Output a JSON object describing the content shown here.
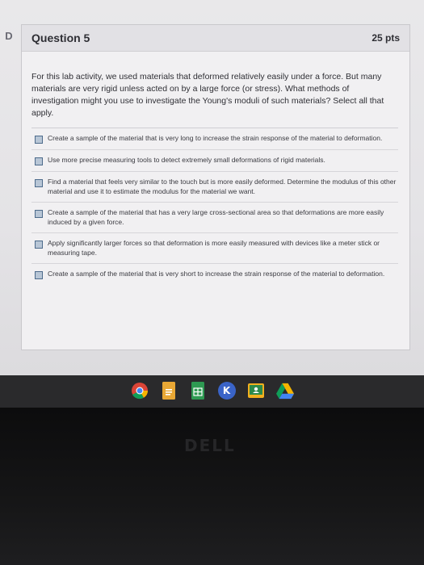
{
  "nav": {
    "side_tab_glyph": "D"
  },
  "question": {
    "title": "Question 5",
    "points": "25 pts",
    "prompt": "For this lab activity, we used materials that deformed relatively easily under a force. But many materials are very rigid unless acted on by a large force (or stress). What methods of investigation might you use to investigate the Young's moduli of such materials? Select all that apply."
  },
  "answers": [
    {
      "text": "Create a sample of the material that is very long to increase the strain response of the material to deformation."
    },
    {
      "text": "Use more precise measuring tools to detect extremely small deformations of rigid materials."
    },
    {
      "text": "Find a material that feels very similar to the touch but is more easily deformed. Determine the modulus of this other material and use it to estimate the modulus for the material we want."
    },
    {
      "text": "Create a sample of the material that has a very large cross-sectional area so that deformations are more easily induced by a given force."
    },
    {
      "text": "Apply significantly larger forces so that deformation is more easily measured with devices like a meter stick or measuring tape."
    },
    {
      "text": "Create a sample of the material that is very short to increase the strain response of the material to deformation."
    }
  ],
  "taskbar": {
    "apps": [
      {
        "icon": "chrome-icon",
        "glyph": "",
        "color": "#e0a020"
      },
      {
        "icon": "docs-icon",
        "glyph": "",
        "color": "#e8a735"
      },
      {
        "icon": "sheets-icon",
        "glyph": "▦",
        "color": "#2e9a52"
      },
      {
        "icon": "k-app-icon",
        "glyph": "K",
        "color": "#3a64c8"
      },
      {
        "icon": "classroom-icon",
        "glyph": "",
        "color": "#2c8a4a"
      },
      {
        "icon": "drive-icon",
        "glyph": "",
        "color": "#f2b01e"
      }
    ]
  },
  "device": {
    "brand": "DELL"
  }
}
